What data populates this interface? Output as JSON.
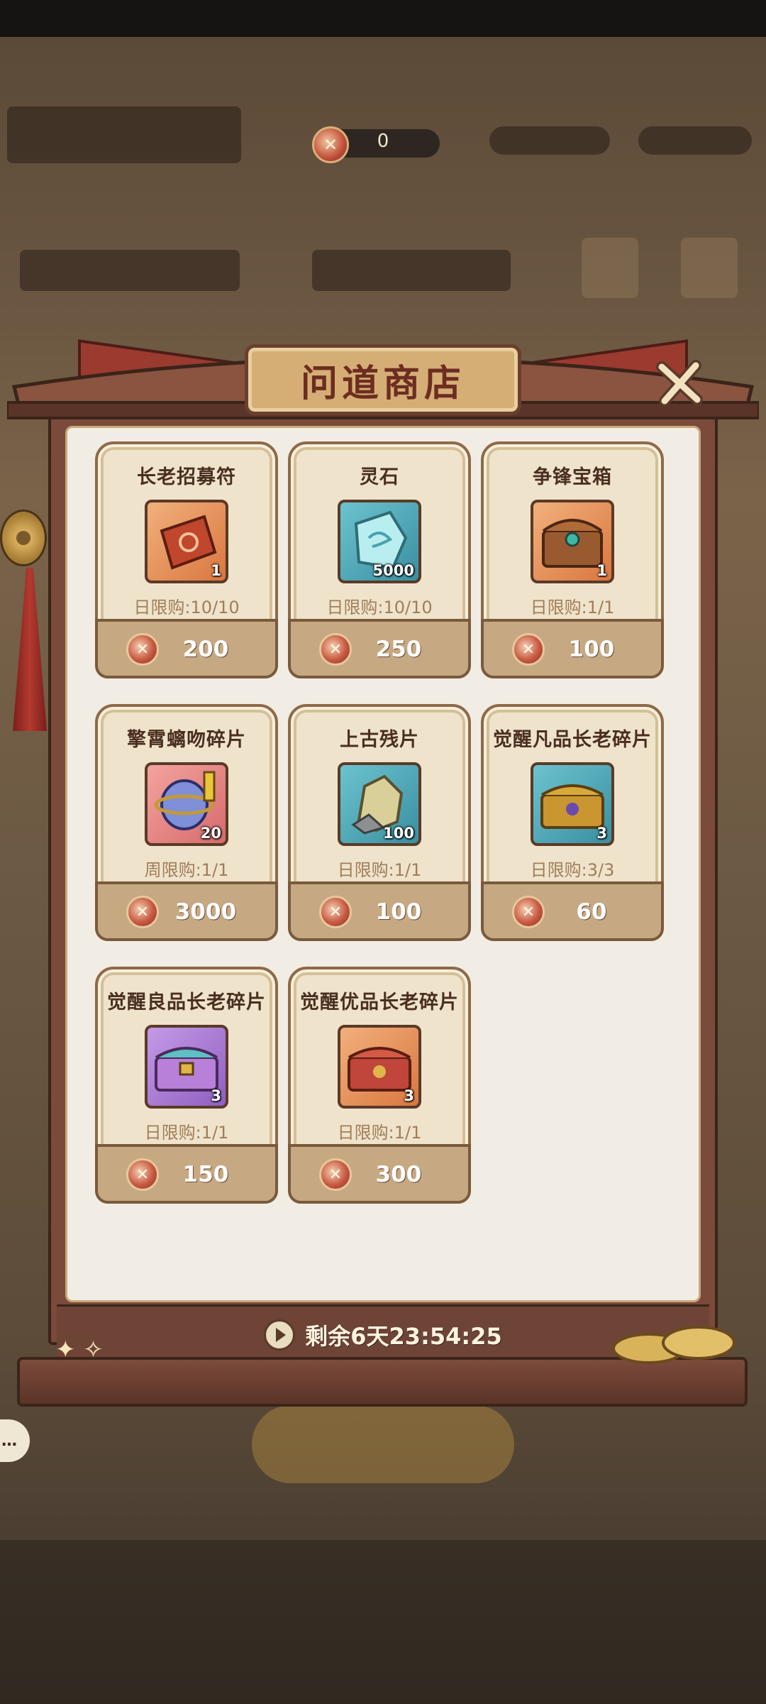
{
  "currency": {
    "icon": "crossed-swords-token-icon",
    "value": "0"
  },
  "shop": {
    "title": "问道商店",
    "timer_label": "剩余6天23:54:25",
    "items": [
      {
        "name": "长老招募符",
        "qty": "1",
        "limit": "日限购:10/10",
        "price": "200",
        "icon": "recruit-talisman-icon",
        "bg": "orange"
      },
      {
        "name": "灵石",
        "qty": "5000",
        "limit": "日限购:10/10",
        "price": "250",
        "icon": "spirit-stone-icon",
        "bg": "teal"
      },
      {
        "name": "争锋宝箱",
        "qty": "1",
        "limit": "日限购:1/1",
        "price": "100",
        "icon": "treasure-chest-icon",
        "bg": "orange"
      },
      {
        "name": "擎霄螭吻碎片",
        "qty": "20",
        "limit": "周限购:1/1",
        "price": "3000",
        "icon": "relic-fragment-icon",
        "bg": "pink"
      },
      {
        "name": "上古残片",
        "qty": "100",
        "limit": "日限购:1/1",
        "price": "100",
        "icon": "ancient-shard-icon",
        "bg": "teal"
      },
      {
        "name": "觉醒凡品长老碎片",
        "qty": "3",
        "limit": "日限购:3/3",
        "price": "60",
        "icon": "gold-chest-icon",
        "bg": "teal"
      },
      {
        "name": "觉醒良品长老碎片",
        "qty": "3",
        "limit": "日限购:1/1",
        "price": "150",
        "icon": "purple-chest-icon",
        "bg": "purple"
      },
      {
        "name": "觉醒优品长老碎片",
        "qty": "3",
        "limit": "日限购:1/1",
        "price": "300",
        "icon": "red-chest-icon",
        "bg": "orange"
      }
    ]
  },
  "colors": {
    "accent": "#c95a44",
    "frame": "#7a4a3a",
    "panel": "#f2ede4",
    "title_text": "#6d2d20"
  }
}
